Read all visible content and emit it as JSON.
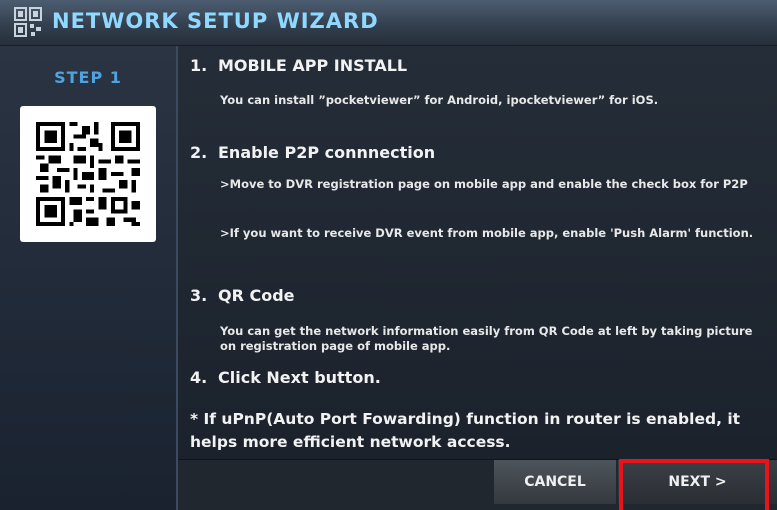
{
  "window": {
    "title": "NETWORK SETUP WIZARD",
    "icon": "qr-grid-icon"
  },
  "sidebar": {
    "step_label": "STEP 1",
    "qr_image": "qr-code"
  },
  "steps": [
    {
      "num": "1.",
      "heading": "MOBILE APP INSTALL",
      "lines": [
        "You can install ”pocketviewer” for Android, ipocketviewer” for iOS."
      ]
    },
    {
      "num": "2.",
      "heading": "Enable P2P connnection",
      "lines": [
        ">Move to DVR registration page on mobile app and enable the check box for P2P",
        ">If you want to receive DVR event from mobile app, enable 'Push Alarm' function."
      ]
    },
    {
      "num": "3.",
      "heading": "QR Code",
      "lines": [
        "You can get the network information easily from QR Code at left by taking picture on registration page of mobile app."
      ]
    },
    {
      "num": "4.",
      "heading": "Click Next button.",
      "lines": []
    }
  ],
  "note": "* If uPnP(Auto Port Fowarding) function in router is enabled, it helps more efficient network access.",
  "footer": {
    "cancel_label": "CANCEL",
    "next_label": "NEXT >"
  },
  "colors": {
    "title_text": "#8fd8ff",
    "step_label": "#4fa3e0",
    "highlight": "#e8141c"
  }
}
